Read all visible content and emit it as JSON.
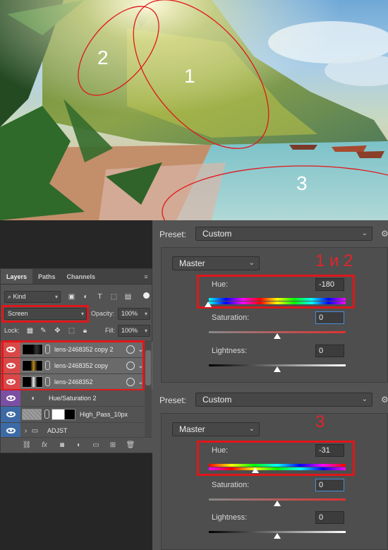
{
  "photo": {
    "annotations": [
      "1",
      "2",
      "3"
    ],
    "ellipse_color": "#e2161a"
  },
  "layers_panel": {
    "tabs": [
      "Layers",
      "Paths",
      "Channels"
    ],
    "filter_kind": "Kind",
    "blend_mode": "Screen",
    "opacity_label": "Opacity:",
    "opacity_value": "100%",
    "lock_label": "Lock:",
    "fill_label": "Fill:",
    "fill_value": "100%",
    "layers": [
      {
        "name": "lens-2468352 copy 2",
        "visible": true,
        "selected": true,
        "type": "smart"
      },
      {
        "name": "lens-2468352 copy",
        "visible": true,
        "selected": true,
        "type": "smart"
      },
      {
        "name": "lens-2468352",
        "visible": true,
        "selected": true,
        "type": "smart"
      },
      {
        "name": "Hue/Saturation 2",
        "visible": true,
        "selected": false,
        "type": "adjustment"
      },
      {
        "name": "High_Pass_10px",
        "visible": true,
        "selected": false,
        "type": "masked"
      },
      {
        "name": "ADJST",
        "visible": true,
        "selected": false,
        "type": "group"
      }
    ]
  },
  "hue_sat_top": {
    "preset_label": "Preset:",
    "preset_value": "Custom",
    "channel": "Master",
    "annotation": "1 и 2",
    "hue_label": "Hue:",
    "hue_value": "-180",
    "saturation_label": "Saturation:",
    "saturation_value": "0",
    "lightness_label": "Lightness:",
    "lightness_value": "0"
  },
  "hue_sat_bottom": {
    "preset_label": "Preset:",
    "preset_value": "Custom",
    "channel": "Master",
    "annotation": "3",
    "hue_label": "Hue:",
    "hue_value": "-31",
    "saturation_label": "Saturation:",
    "saturation_value": "0",
    "lightness_label": "Lightness:",
    "lightness_value": "0"
  },
  "colors": {
    "highlight_red": "#e0161a",
    "panel_bg": "#535353",
    "eye_selected_bg": "#d94848",
    "eye_purple_bg": "#7b4fa3",
    "eye_blue_bg": "#3d6aa6"
  }
}
